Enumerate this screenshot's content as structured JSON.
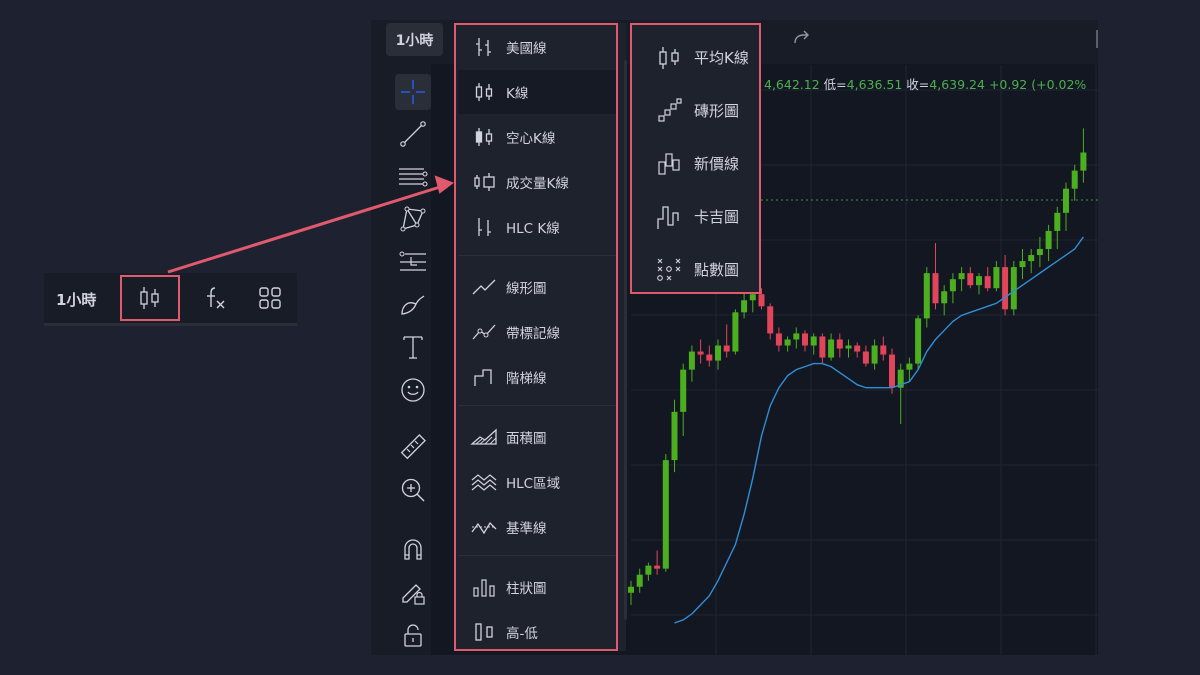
{
  "mini_toolbar": {
    "interval": "1小時",
    "icons": [
      "candles-icon",
      "fx-indicator-icon",
      "layout-grid-icon"
    ]
  },
  "chart_window": {
    "interval_button": "1小時",
    "ohlc": {
      "high_value": "4,642.12",
      "low_label": "低=",
      "low_value": "4,636.51",
      "close_label": "收=",
      "close_value": "4,639.24",
      "change": "+0.92",
      "change_pct": "(+0.02%"
    },
    "left_tools": [
      "crosshair-icon",
      "trend-line-icon",
      "parallel-channel-icon",
      "pattern-icon",
      "fib-retracement-icon",
      "brush-icon",
      "text-icon",
      "emoji-icon",
      "ruler-icon",
      "zoom-in-icon",
      "magnet-icon",
      "lock-pencil-icon",
      "unlock-icon"
    ]
  },
  "chart_type_menu": {
    "items": [
      {
        "label": "美國線",
        "icon": "bars-icon"
      },
      {
        "label": "K線",
        "icon": "candles-icon",
        "selected": true
      },
      {
        "label": "空心K線",
        "icon": "hollow-candles-icon"
      },
      {
        "label": "成交量K線",
        "icon": "volume-candles-icon"
      },
      {
        "label": "HLC K線",
        "icon": "hlc-bars-icon"
      },
      {
        "label": "線形圖",
        "icon": "line-icon"
      },
      {
        "label": "帶標記線",
        "icon": "line-markers-icon"
      },
      {
        "label": "階梯線",
        "icon": "step-line-icon"
      },
      {
        "label": "面積圖",
        "icon": "area-icon"
      },
      {
        "label": "HLC區域",
        "icon": "hlc-area-icon"
      },
      {
        "label": "基準線",
        "icon": "baseline-icon"
      },
      {
        "label": "柱狀圖",
        "icon": "columns-icon"
      },
      {
        "label": "高-低",
        "icon": "high-low-icon"
      }
    ]
  },
  "more_types_menu": {
    "items": [
      {
        "label": "平均K線",
        "icon": "heikin-ashi-icon"
      },
      {
        "label": "磚形圖",
        "icon": "renko-icon"
      },
      {
        "label": "新價線",
        "icon": "line-break-icon"
      },
      {
        "label": "卡吉圖",
        "icon": "kagi-icon"
      },
      {
        "label": "點數圖",
        "icon": "point-figure-icon"
      }
    ]
  },
  "colors": {
    "background": "#1e2230",
    "panel": "#181c27",
    "chart_bg": "#131722",
    "highlight_border": "#e05a6e",
    "up_candle": "#4caf1f",
    "down_candle": "#e0455a",
    "ma_line": "#2f8fd6",
    "ohlc_value": "#4caf50"
  },
  "chart_data": {
    "type": "candlestick",
    "interval": "1小時",
    "candles": [
      {
        "o": 4,
        "h": 8,
        "l": 0,
        "c": 6
      },
      {
        "o": 6,
        "h": 12,
        "l": 4,
        "c": 10
      },
      {
        "o": 10,
        "h": 14,
        "l": 8,
        "c": 13
      },
      {
        "o": 13,
        "h": 18,
        "l": 10,
        "c": 12
      },
      {
        "o": 12,
        "h": 50,
        "l": 11,
        "c": 48
      },
      {
        "o": 48,
        "h": 68,
        "l": 44,
        "c": 64
      },
      {
        "o": 64,
        "h": 80,
        "l": 56,
        "c": 78
      },
      {
        "o": 78,
        "h": 86,
        "l": 74,
        "c": 84
      },
      {
        "o": 84,
        "h": 88,
        "l": 80,
        "c": 83
      },
      {
        "o": 83,
        "h": 86,
        "l": 79,
        "c": 81
      },
      {
        "o": 81,
        "h": 88,
        "l": 78,
        "c": 86
      },
      {
        "o": 86,
        "h": 93,
        "l": 82,
        "c": 84
      },
      {
        "o": 84,
        "h": 98,
        "l": 83,
        "c": 97
      },
      {
        "o": 97,
        "h": 104,
        "l": 95,
        "c": 101
      },
      {
        "o": 101,
        "h": 106,
        "l": 97,
        "c": 103
      },
      {
        "o": 103,
        "h": 105,
        "l": 98,
        "c": 99
      },
      {
        "o": 99,
        "h": 100,
        "l": 88,
        "c": 90
      },
      {
        "o": 90,
        "h": 92,
        "l": 84,
        "c": 86
      },
      {
        "o": 86,
        "h": 89,
        "l": 84,
        "c": 88
      },
      {
        "o": 88,
        "h": 92,
        "l": 85,
        "c": 90
      },
      {
        "o": 90,
        "h": 91,
        "l": 84,
        "c": 86
      },
      {
        "o": 86,
        "h": 90,
        "l": 83,
        "c": 89
      },
      {
        "o": 89,
        "h": 90,
        "l": 80,
        "c": 82
      },
      {
        "o": 82,
        "h": 90,
        "l": 81,
        "c": 88
      },
      {
        "o": 88,
        "h": 90,
        "l": 82,
        "c": 85
      },
      {
        "o": 85,
        "h": 88,
        "l": 82,
        "c": 86
      },
      {
        "o": 86,
        "h": 87,
        "l": 82,
        "c": 84
      },
      {
        "o": 84,
        "h": 86,
        "l": 79,
        "c": 80
      },
      {
        "o": 80,
        "h": 88,
        "l": 78,
        "c": 86
      },
      {
        "o": 86,
        "h": 89,
        "l": 81,
        "c": 83
      },
      {
        "o": 83,
        "h": 85,
        "l": 70,
        "c": 72
      },
      {
        "o": 72,
        "h": 80,
        "l": 60,
        "c": 78
      },
      {
        "o": 78,
        "h": 82,
        "l": 74,
        "c": 80
      },
      {
        "o": 80,
        "h": 96,
        "l": 78,
        "c": 95
      },
      {
        "o": 95,
        "h": 112,
        "l": 92,
        "c": 110
      },
      {
        "o": 110,
        "h": 120,
        "l": 98,
        "c": 100
      },
      {
        "o": 100,
        "h": 106,
        "l": 96,
        "c": 104
      },
      {
        "o": 104,
        "h": 110,
        "l": 100,
        "c": 108
      },
      {
        "o": 108,
        "h": 112,
        "l": 104,
        "c": 110
      },
      {
        "o": 110,
        "h": 112,
        "l": 105,
        "c": 106
      },
      {
        "o": 106,
        "h": 110,
        "l": 103,
        "c": 109
      },
      {
        "o": 109,
        "h": 112,
        "l": 104,
        "c": 105
      },
      {
        "o": 105,
        "h": 114,
        "l": 104,
        "c": 112
      },
      {
        "o": 112,
        "h": 116,
        "l": 96,
        "c": 98
      },
      {
        "o": 98,
        "h": 114,
        "l": 96,
        "c": 112
      },
      {
        "o": 112,
        "h": 118,
        "l": 108,
        "c": 114
      },
      {
        "o": 114,
        "h": 118,
        "l": 110,
        "c": 116
      },
      {
        "o": 116,
        "h": 122,
        "l": 112,
        "c": 118
      },
      {
        "o": 118,
        "h": 126,
        "l": 114,
        "c": 124
      },
      {
        "o": 124,
        "h": 132,
        "l": 118,
        "c": 130
      },
      {
        "o": 130,
        "h": 140,
        "l": 124,
        "c": 138
      },
      {
        "o": 138,
        "h": 146,
        "l": 134,
        "c": 144
      },
      {
        "o": 144,
        "h": 158,
        "l": 140,
        "c": 150
      }
    ],
    "ma": [
      -6,
      -5,
      -3,
      0,
      3,
      8,
      14,
      20,
      30,
      42,
      56,
      66,
      72,
      76,
      78,
      79,
      80,
      80,
      79,
      77,
      75,
      73,
      72,
      72,
      72,
      72,
      73,
      74,
      78,
      84,
      88,
      91,
      94,
      96,
      97,
      98,
      99,
      100,
      102,
      104,
      106,
      108,
      110,
      112,
      114,
      116,
      118,
      122
    ],
    "ylim": [
      -10,
      170
    ]
  }
}
